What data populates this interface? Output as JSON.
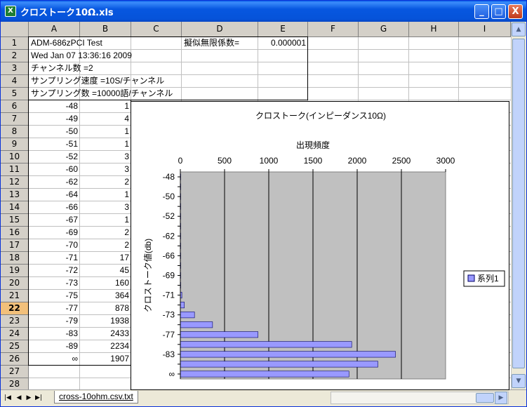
{
  "window": {
    "title": "クロストーク10Ω.xls",
    "app_icon_label": "X",
    "minimize": "_",
    "maximize": "□",
    "close": "X"
  },
  "columns": [
    "A",
    "B",
    "C",
    "D",
    "E",
    "F",
    "G",
    "H",
    "I"
  ],
  "rows": [
    "1",
    "2",
    "3",
    "4",
    "5",
    "6",
    "7",
    "8",
    "9",
    "10",
    "11",
    "12",
    "13",
    "14",
    "15",
    "16",
    "17",
    "18",
    "19",
    "20",
    "21",
    "22",
    "23",
    "24",
    "25",
    "26",
    "27",
    "28"
  ],
  "selected_row": "22",
  "header_cells": {
    "a1": "ADM-686zPCI Test",
    "d1": "擬似無限係数=",
    "e1": "0.000001",
    "a2": "Wed Jan 07 13:36:16 2009",
    "a3": "チャンネル数 =2",
    "a4": "サンプリング速度 =10S/チャンネル",
    "a5": "サンプリング数 =10000語/チャンネル"
  },
  "table": [
    {
      "a": "-48",
      "b": "1"
    },
    {
      "a": "-49",
      "b": "4"
    },
    {
      "a": "-50",
      "b": "1"
    },
    {
      "a": "-51",
      "b": "1"
    },
    {
      "a": "-52",
      "b": "3"
    },
    {
      "a": "-60",
      "b": "3"
    },
    {
      "a": "-62",
      "b": "2"
    },
    {
      "a": "-64",
      "b": "1"
    },
    {
      "a": "-66",
      "b": "3"
    },
    {
      "a": "-67",
      "b": "1"
    },
    {
      "a": "-69",
      "b": "2"
    },
    {
      "a": "-70",
      "b": "2"
    },
    {
      "a": "-71",
      "b": "17"
    },
    {
      "a": "-72",
      "b": "45"
    },
    {
      "a": "-73",
      "b": "160"
    },
    {
      "a": "-75",
      "b": "364"
    },
    {
      "a": "-77",
      "b": "878"
    },
    {
      "a": "-79",
      "b": "1938"
    },
    {
      "a": "-83",
      "b": "2433"
    },
    {
      "a": "-89",
      "b": "2234"
    },
    {
      "a": "∞",
      "b": "1907"
    }
  ],
  "sheet_tab": "cross-10ohm.csv.txt",
  "chart_data": {
    "type": "bar",
    "orientation": "horizontal",
    "title": "クロストーク(インピーダンス10Ω)",
    "xlabel": "出現頻度",
    "ylabel": "クロストーク値(db)",
    "x_axis_position": "top",
    "xlim": [
      0,
      3000
    ],
    "x_ticks": [
      "0",
      "500",
      "1000",
      "1500",
      "2000",
      "2500",
      "3000"
    ],
    "categories": [
      "-48",
      "-49",
      "-50",
      "-51",
      "-52",
      "-60",
      "-62",
      "-64",
      "-66",
      "-67",
      "-69",
      "-70",
      "-71",
      "-72",
      "-73",
      "-75",
      "-77",
      "-79",
      "-83",
      "-89",
      "∞"
    ],
    "y_tick_labels": [
      "-48",
      "-50",
      "-52",
      "-62",
      "-66",
      "-69",
      "-71",
      "-73",
      "-77",
      "-83",
      "∞"
    ],
    "series": [
      {
        "name": "系列1",
        "values": [
          1,
          4,
          1,
          1,
          3,
          3,
          2,
          1,
          3,
          1,
          2,
          2,
          17,
          45,
          160,
          364,
          878,
          1938,
          2433,
          2234,
          1907
        ]
      }
    ],
    "legend": "right",
    "plot_background": "#c0c0c0",
    "bar_color": "#9999ff",
    "grid": true
  }
}
